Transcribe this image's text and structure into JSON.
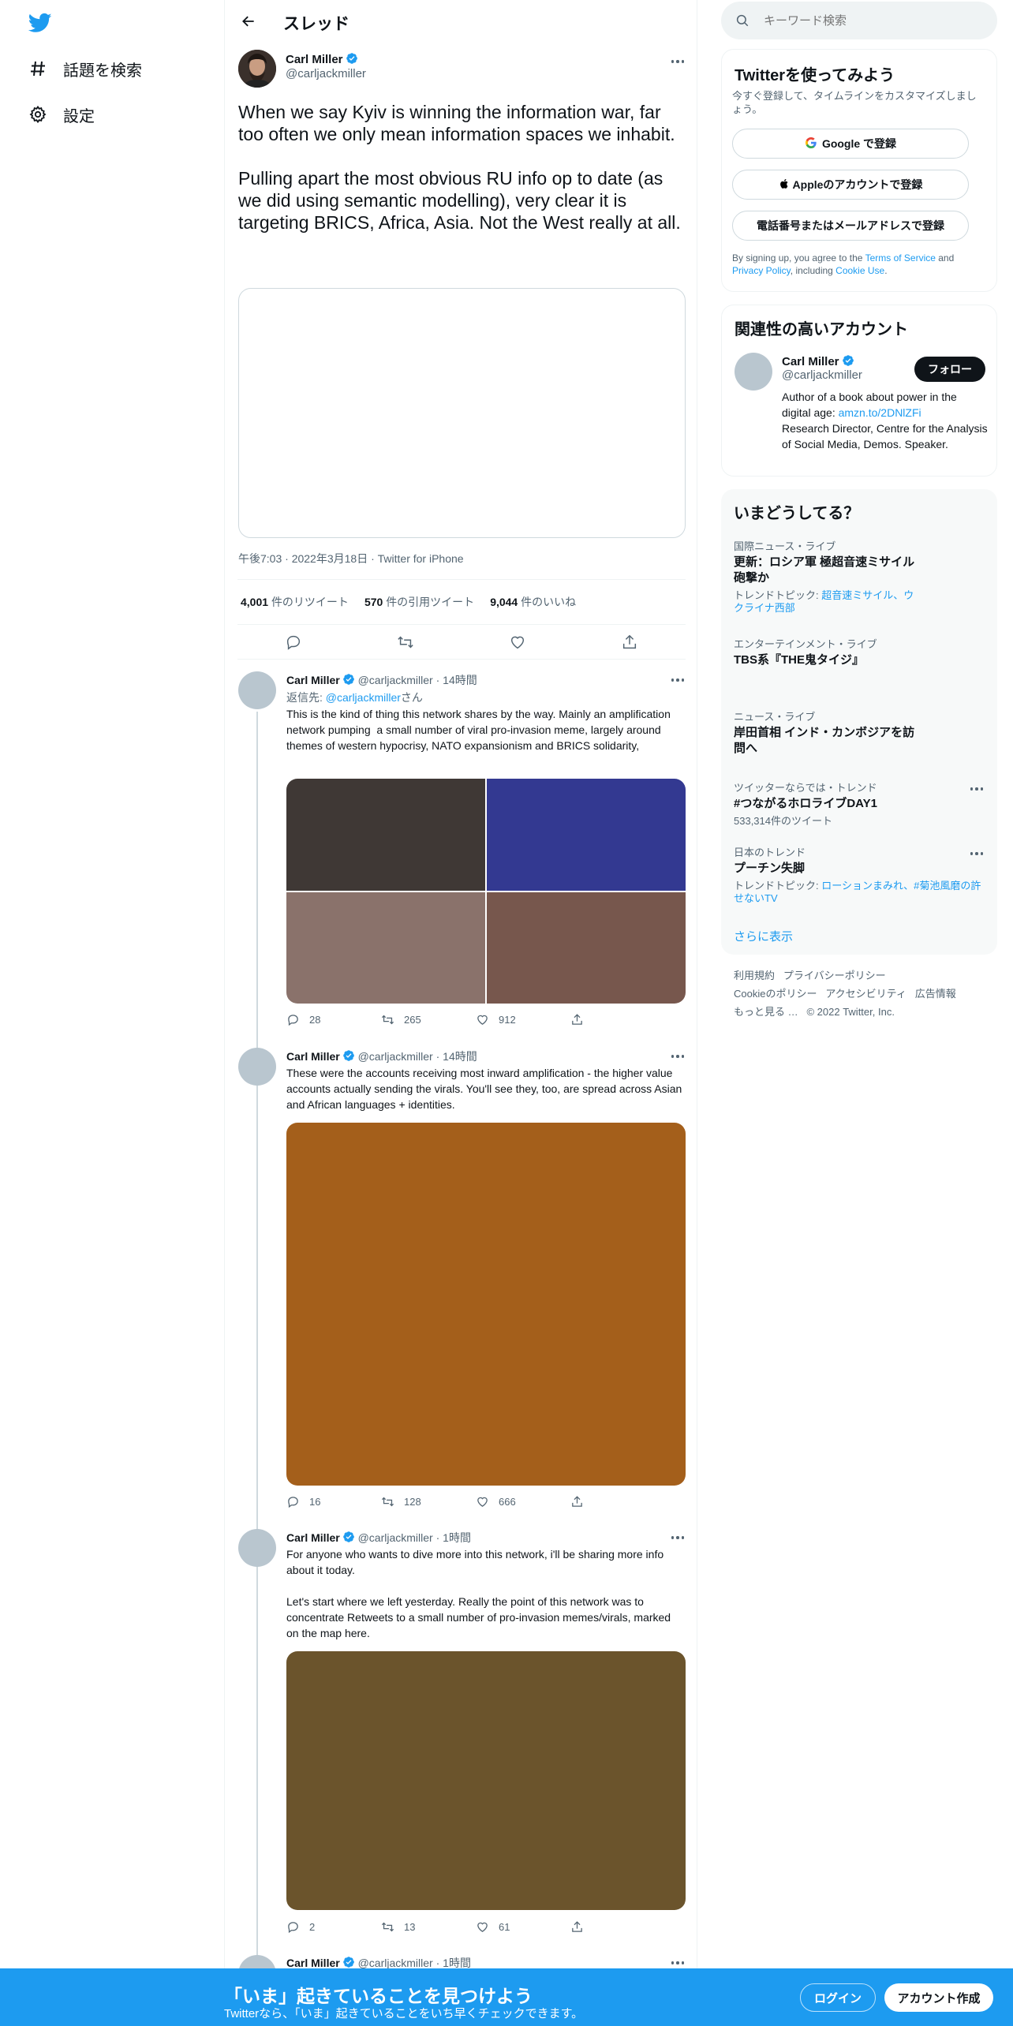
{
  "nav": {
    "items": [
      {
        "label": "話題を検索",
        "icon": "hashtag-icon"
      },
      {
        "label": "設定",
        "icon": "gear-icon"
      }
    ]
  },
  "header": {
    "title": "スレッド"
  },
  "main_tweet": {
    "name": "Carl Miller",
    "handle": "@carljackmiller",
    "text": "When we say Kyiv is winning the information war, far too often we only mean information spaces we inhabit.\n\nPulling apart the most obvious RU info op to date (as we did using semantic modelling), very clear it is targeting BRICS, Africa, Asia. Not the West really at all.",
    "meta": "午後7:03 · 2022年3月18日 · Twitter for iPhone",
    "stats": [
      {
        "num": "4,001",
        "label": "件のリツイート"
      },
      {
        "num": "570",
        "label": "件の引用ツイート"
      },
      {
        "num": "9,044",
        "label": "件のいいね"
      }
    ]
  },
  "replies": [
    {
      "name": "Carl Miller",
      "handle": "@carljackmiller",
      "time": "14時間",
      "reply_prefix": "返信先: ",
      "reply_to": "@carljackmiller",
      "reply_suffix": "さん",
      "text": "This is the kind of thing this network shares by the way. Mainly an amplification network pumping  a small number of viral pro-invasion meme, largely around themes of western hypocrisy, NATO expansionism and BRICS solidarity,",
      "image_colors": [
        "#3f3835",
        "#333991",
        "#8a726b",
        "#77574d"
      ],
      "replies": "28",
      "retweets": "265",
      "likes": "912"
    },
    {
      "name": "Carl Miller",
      "handle": "@carljackmiller",
      "time": "14時間",
      "text": "These were the accounts receiving most inward amplification - the higher value accounts actually sending the virals. You'll see they, too, are spread across Asian and African languages + identities.",
      "image_colors": [
        "#a45f1b"
      ],
      "replies": "16",
      "retweets": "128",
      "likes": "666"
    },
    {
      "name": "Carl Miller",
      "handle": "@carljackmiller",
      "time": "1時間",
      "text": "For anyone who wants to dive more into this network, i'll be sharing more info about it today.\n\nLet's start where we left yesterday. Really the point of this network was to concentrate Retweets to a small number of pro-invasion memes/virals, marked on the map here.",
      "image_colors": [
        "#6b542c"
      ],
      "replies": "2",
      "retweets": "13",
      "likes": "61"
    },
    {
      "name": "Carl Miller",
      "handle": "@carljackmiller",
      "time": "1時間"
    }
  ],
  "sidebar": {
    "search_placeholder": "キーワード検索",
    "signup": {
      "title": "Twitterを使ってみよう",
      "subtitle": "今すぐ登録して、タイムラインをカスタマイズしましょう。",
      "google": "Google で登録",
      "apple": "Appleのアカウントで登録",
      "phone": "電話番号またはメールアドレスで登録",
      "legal_1": "By signing up, you agree to the ",
      "legal_tos": "Terms of Service",
      "legal_2": " and ",
      "legal_privacy": "Privacy Policy",
      "legal_3": ", including ",
      "legal_cookie": "Cookie Use",
      "legal_4": "."
    },
    "relevant": {
      "title": "関連性の高いアカウント",
      "name": "Carl Miller",
      "handle": "@carljackmiller",
      "follow": "フォロー",
      "bio_1": "Author of a book about power in the digital age: ",
      "bio_link": "amzn.to/2DNlZFi",
      "bio_2": "Research Director, Centre for the Analysis of Social Media, Demos. Speaker."
    },
    "trends": {
      "title": "いまどうしてる？",
      "items": [
        {
          "context": "国際ニュース・ライブ",
          "title": "更新：ロシア軍 極超音速ミサイル砲撃か",
          "sub_prefix": "トレンドトピック: ",
          "sub_links": "超音速ミサイル、ウクライナ西部"
        },
        {
          "context": "エンターテインメント・ライブ",
          "title": "TBS系『THE鬼タイジ』"
        },
        {
          "context": "ニュース・ライブ",
          "title": "岸田首相 インド・カンボジアを訪問へ"
        },
        {
          "context": "ツイッターならでは・トレンド",
          "title": "#つながるホロライブDAY1",
          "sub": "533,314件のツイート"
        },
        {
          "context": "日本のトレンド",
          "title": "プーチン失脚",
          "sub_prefix": "トレンドトピック: ",
          "sub_links": "ローションまみれ、#菊池風磨の許せないTV"
        }
      ],
      "show_more": "さらに表示"
    },
    "footer": {
      "line1": [
        "利用規約",
        "プライバシーポリシー"
      ],
      "line2": [
        "Cookieのポリシー",
        "アクセシビリティ",
        "広告情報"
      ],
      "line3": [
        "もっと見る …",
        "© 2022 Twitter, Inc."
      ]
    }
  },
  "bottom_bar": {
    "headline": "「いま」起きていることを見つけよう",
    "sub": "Twitterなら、「いま」起きていることをいち早くチェックできます。",
    "login": "ログイン",
    "signup": "アカウント作成"
  },
  "colors": {
    "accent": "#1d9bf0",
    "text": "#0f1419",
    "muted": "#536471"
  }
}
